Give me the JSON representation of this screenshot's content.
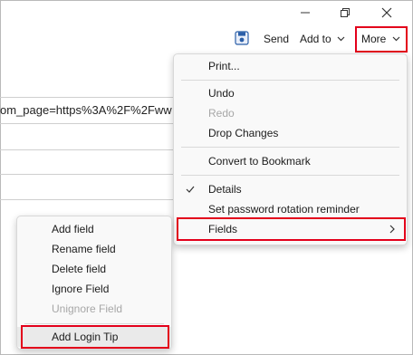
{
  "window": {
    "minimize_icon": "minimize-icon",
    "restore_icon": "restore-icon",
    "close_icon": "close-icon"
  },
  "toolbar": {
    "save_icon": "save-icon",
    "send_label": "Send",
    "add_to_label": "Add to",
    "more_label": "More"
  },
  "page": {
    "url_fragment": "om_page=https%3A%2F%2Fww"
  },
  "more_menu": {
    "print": "Print...",
    "undo": "Undo",
    "redo": "Redo",
    "drop_changes": "Drop Changes",
    "convert": "Convert to Bookmark",
    "details": "Details",
    "rotation": "Set password rotation reminder",
    "fields": "Fields"
  },
  "fields_menu": {
    "add_field": "Add field",
    "rename_field": "Rename field",
    "delete_field": "Delete field",
    "ignore_field": "Ignore Field",
    "unignore_field": "Unignore Field",
    "add_login_tip": "Add Login Tip"
  },
  "colors": {
    "highlight": "#e3001b",
    "accent": "#1a73e8"
  }
}
